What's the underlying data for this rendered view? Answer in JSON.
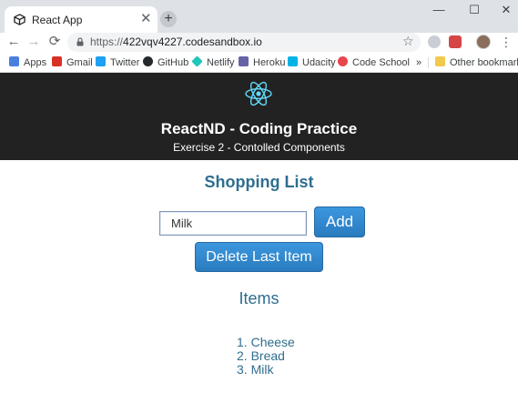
{
  "browser": {
    "tab_title": "React App",
    "tab_close_glyph": "✕",
    "new_tab_glyph": "+",
    "window_controls": {
      "minimize": "—",
      "maximize": "☐",
      "close": "✕"
    },
    "nav": {
      "back": "←",
      "forward": "→",
      "reload": "⟳"
    },
    "url_scheme": "https://",
    "url_host": "422vqv4227.codesandbox.io",
    "bookmark_star_glyph": "☆",
    "menu_glyph": "⋮",
    "bookmarks": [
      {
        "label": "Apps",
        "icon": "apps-grid-icon",
        "color": "#4a7fe0"
      },
      {
        "label": "Gmail",
        "icon": "gmail-icon",
        "color": "#d93025"
      },
      {
        "label": "Twitter",
        "icon": "twitter-icon",
        "color": "#1da1f2"
      },
      {
        "label": "GitHub",
        "icon": "github-icon",
        "color": "#24292e"
      },
      {
        "label": "Netlify",
        "icon": "netlify-icon",
        "color": "#20c6b7"
      },
      {
        "label": "Heroku",
        "icon": "heroku-icon",
        "color": "#6762a6"
      },
      {
        "label": "Udacity",
        "icon": "udacity-icon",
        "color": "#02b3e4"
      },
      {
        "label": "Code School",
        "icon": "code-school-icon",
        "color": "#e8464b"
      }
    ],
    "bookmarks_overflow_glyph": "»",
    "other_bookmarks": {
      "label": "Other bookmarks",
      "icon": "folder-icon",
      "color": "#f2c94c"
    }
  },
  "header": {
    "title": "ReactND - Coding Practice",
    "subtitle": "Exercise 2 - Contolled Components",
    "background_color": "#222222",
    "logo_color": "#61dafb"
  },
  "main": {
    "heading": "Shopping List",
    "input_value": "Milk",
    "add_button_label": "Add",
    "delete_button_label": "Delete Last Item",
    "items_heading": "Items",
    "items": [
      "Cheese",
      "Bread",
      "Milk"
    ],
    "accent_color": "#2f6e8f",
    "button_color": "#2f86cf"
  }
}
